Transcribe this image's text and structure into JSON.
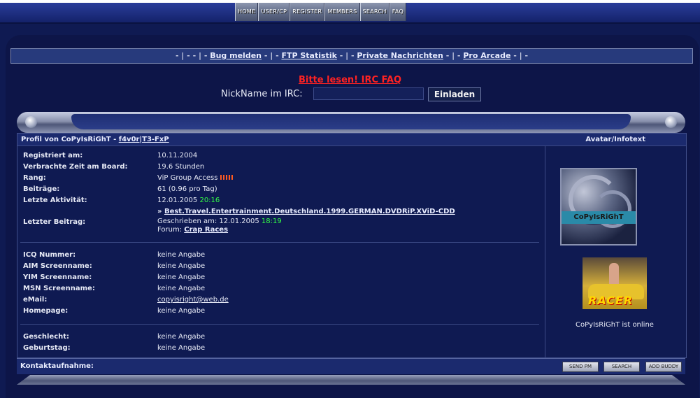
{
  "nav": [
    "HOME",
    "USER/CP",
    "REGISTER",
    "MEMBERS",
    "SEARCH",
    "FAQ"
  ],
  "linkbar": {
    "prefix": "- | - - | - ",
    "bug": "Bug melden",
    "sep1": " - | - ",
    "ftp": "FTP Statistik",
    "sep2": " - | - ",
    "pm": "Private Nachrichten",
    "sep3": " - | - ",
    "arcade": "Pro Arcade",
    "suffix": " - | -"
  },
  "irc": {
    "notice": "Bitte lesen! IRC FAQ",
    "label": "NickName im IRC:",
    "input_value": "",
    "button": "Einladen"
  },
  "profile": {
    "title_prefix": "Profil von CoPyIsRiGhT - ",
    "title_link": "f4v0r|T3-FxP",
    "avatar_header": "Avatar/Infotext",
    "registered_label": "Registriert am:",
    "registered_value": "10.11.2004",
    "time_label": "Verbrachte Zeit am Board:",
    "time_value": "19.6 Stunden",
    "rank_label": "Rang:",
    "rank_value": "ViP Group Access",
    "posts_label": "Beiträge:",
    "posts_value": "61 (0.96 pro Tag)",
    "activity_label": "Letzte Aktivität:",
    "activity_date": "12.01.2005",
    "activity_time": "20:16",
    "lastpost_label": "Letzter Beitrag:",
    "lastpost_prefix": "» ",
    "lastpost_title": "Best.Travel.Entertrainment.Deutschland.1999.GERMAN.DVDRiP.XViD-CDD",
    "lastpost_written": "Geschrieben am: 12.01.2005",
    "lastpost_time": "18:19",
    "lastpost_forum_label": "Forum: ",
    "lastpost_forum": "Crap Races",
    "icq_label": "ICQ Nummer:",
    "icq_value": "keine Angabe",
    "aim_label": "AIM Screenname:",
    "aim_value": "keine Angabe",
    "yim_label": "YIM Screenname:",
    "yim_value": "keine Angabe",
    "msn_label": "MSN Screenname:",
    "msn_value": "keine Angabe",
    "email_label": "eMail:",
    "email_value": "copyisright@web.de",
    "homepage_label": "Homepage:",
    "homepage_value": "keine Angabe",
    "gender_label": "Geschlecht:",
    "gender_value": "keine Angabe",
    "birthday_label": "Geburtstag:",
    "birthday_value": "keine Angabe",
    "avatar_tag": "CoPyIsRiGhT",
    "racer_logo": "RACER",
    "online_text": "CoPyIsRiGhT ist online"
  },
  "contact": {
    "label": "Kontaktaufnahme:",
    "send_pm": "SEND PM",
    "search": "SEARCH",
    "add_buddy": "ADD BUDDY"
  },
  "colors": {
    "accent_red": "#ff2222",
    "time_green": "#33ff44",
    "rank_bars": "#ff5a20"
  }
}
